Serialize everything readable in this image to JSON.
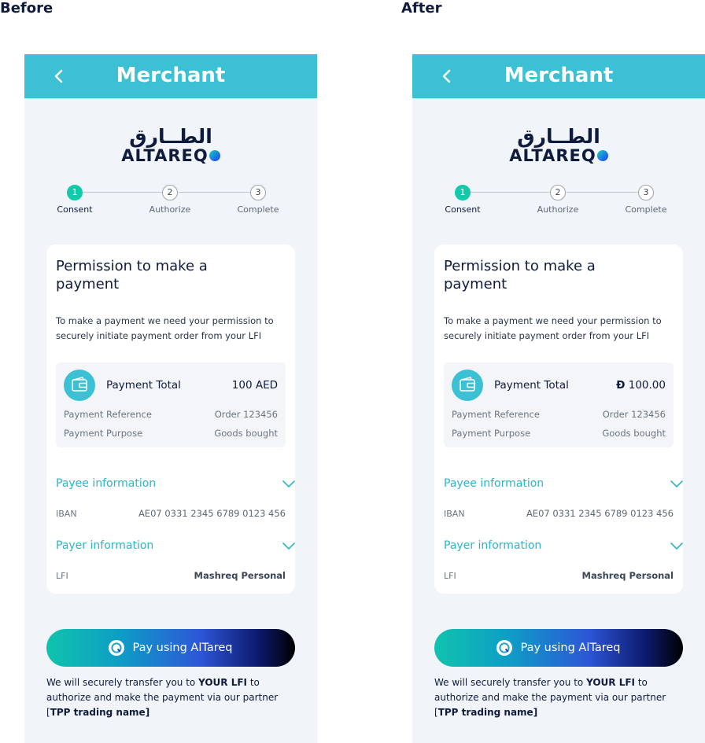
{
  "labels": {
    "before": "Before",
    "after": "After"
  },
  "header": {
    "title": "Merchant"
  },
  "logo": {
    "arabic": "الطــارق",
    "english": "ALTAREQ"
  },
  "steps": [
    {
      "num": "1",
      "label": "Consent"
    },
    {
      "num": "2",
      "label": "Authorize"
    },
    {
      "num": "3",
      "label": "Complete"
    }
  ],
  "active_step": 1,
  "card": {
    "title": "Permission to make a payment",
    "description": "To make a payment we need your permission to securely initiate payment order from your LFI",
    "payment_total_label": "Payment Total",
    "reference_label": "Payment Reference",
    "reference_value": "Order 123456",
    "purpose_label": "Payment Purpose",
    "purpose_value": "Goods bought",
    "payee_title": "Payee information",
    "iban_label": "IBAN",
    "iban_value": "AE07 0331 2345 6789 0123 456",
    "payer_title": "Payer information",
    "lfi_label": "LFI",
    "lfi_value": "Mashreq Personal"
  },
  "before": {
    "amount": "100 AED"
  },
  "after": {
    "currency_symbol": "Ð",
    "amount": "100.00"
  },
  "pay_button": {
    "label": "Pay using AlTareq"
  },
  "footnote": {
    "part1": "We will securely transfer you to ",
    "bold1": "YOUR LFI",
    "part2": " to authorize and make the payment via our partner [",
    "bold2": "TPP trading name]"
  },
  "colors": {
    "header": "#3cc0d3",
    "accent": "#2cb5c9",
    "step_active": "#14c9a9",
    "background": "#f1f5f9"
  },
  "icons": [
    "back-arrow-icon",
    "wallet-icon",
    "chevron-down-icon",
    "altareq-logo-icon"
  ]
}
